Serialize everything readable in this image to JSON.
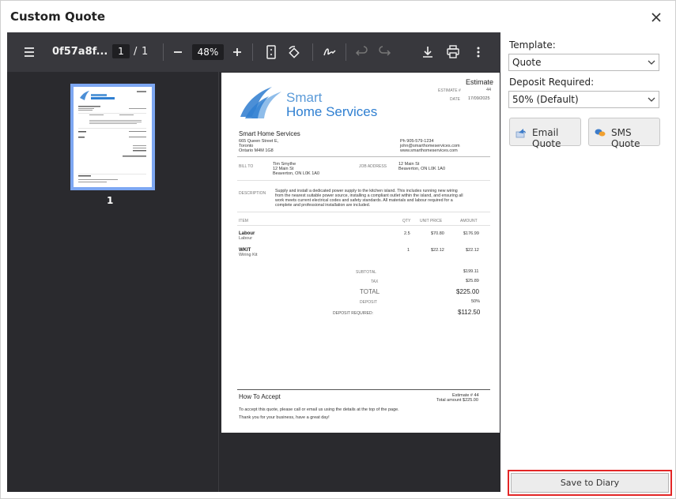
{
  "dialog": {
    "title": "Custom Quote"
  },
  "viewer": {
    "file_name": "0f57a8f...",
    "page_current": "1",
    "page_sep": "/",
    "page_total": "1",
    "zoom": "48%",
    "thumb_label": "1"
  },
  "quote": {
    "logo_line1": "Smart",
    "logo_line2": "Home Services",
    "doc_type": "Estimate",
    "estimate_label": "ESTIMATE #",
    "estimate_no": "44",
    "date_label": "DATE",
    "date": "17/09/2025",
    "company": "Smart Home Services",
    "company_addr1": "665 Queen Street E,",
    "company_addr2": "Toronto",
    "company_addr3": "Ontario M4M 1G8",
    "phone": "Ph 905-579-1234",
    "email": "john@smarthomeservices.com",
    "web": "www.smarthomeservices.com",
    "bill_to_label": "BILL TO",
    "bill_name": "Tim Smythe",
    "bill_addr1": "12 Main St",
    "bill_addr2": "Beaverton, ON L0K 1A0",
    "job_label": "JOB ADDRESS",
    "job_addr1": "12 Main St",
    "job_addr2": "Beaverton, ON L0K 1A0",
    "desc_label": "DESCRIPTION",
    "desc_line1": "Supply and install a dedicated power supply to the kitchen island. This includes running new wiring",
    "desc_line2": "from the nearest suitable power source, installing a compliant outlet within the island, and ensuring all",
    "desc_line3": "work meets current electrical codes and safety standards. All materials and labour required for a",
    "desc_line4": "complete and professional installation are included.",
    "col_item": "ITEM",
    "col_qty": "QTY",
    "col_price": "UNIT PRICE",
    "col_amount": "AMOUNT",
    "items": [
      {
        "name": "Labour",
        "sub": "Labour",
        "qty": "2.5",
        "price": "$70.80",
        "amount": "$176.99"
      },
      {
        "name": "WKIT",
        "sub": "Wiring Kit",
        "qty": "1",
        "price": "$22.12",
        "amount": "$22.12"
      }
    ],
    "subtotal_label": "SUBTOTAL",
    "subtotal": "$199.11",
    "tax_label": "TAX",
    "tax": "$25.89",
    "total_label": "TOTAL",
    "total": "$225.00",
    "deposit_label": "DEPOSIT",
    "deposit": "50%",
    "deposit_req_label": "DEPOSIT REQUIRED:",
    "deposit_req": "$112.50",
    "accept_title": "How To Accept",
    "accept_est": "Estimate # 44",
    "accept_total": "Total amount $225.00",
    "accept_line1": "To accept this quote, please call or email us using the details at the top of the page.",
    "accept_line2": "Thank you for your business, have a great day!"
  },
  "panel": {
    "template_label": "Template:",
    "template_value": "Quote",
    "deposit_label": "Deposit Required:",
    "deposit_value": "50% (Default)",
    "email_button": "Email Quote",
    "sms_button": "SMS Quote",
    "save_button": "Save to Diary"
  },
  "colors": {
    "accent_blue": "#2f7fd1",
    "save_highlight": "#e32626"
  }
}
